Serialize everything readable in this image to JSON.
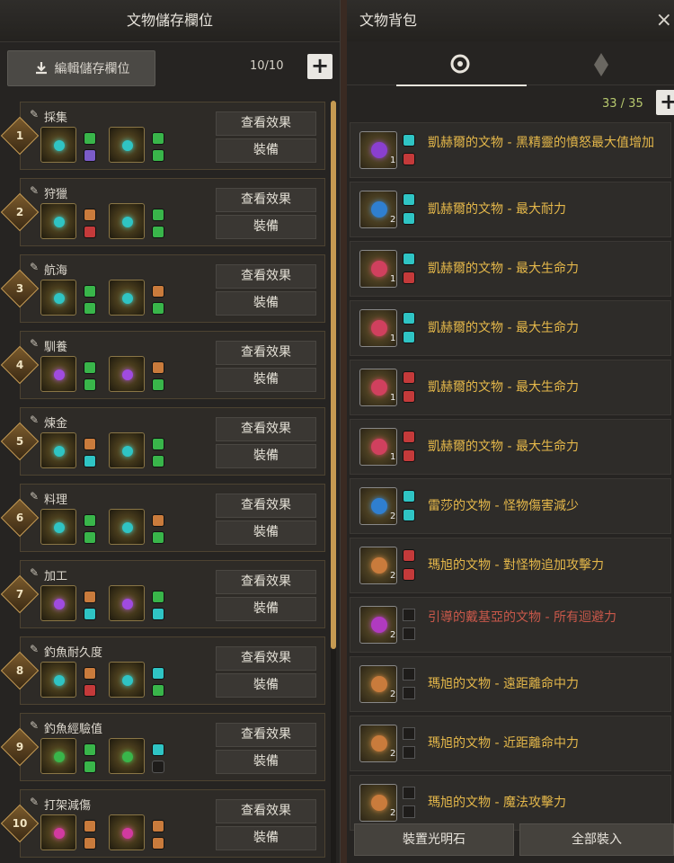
{
  "left_panel": {
    "title": "文物儲存欄位",
    "edit_label": "編輯儲存欄位",
    "slot_count": "10/10",
    "view_label": "查看效果",
    "equip_label": "裝備",
    "slots": [
      {
        "num": "1",
        "name": "採集"
      },
      {
        "num": "2",
        "name": "狩獵"
      },
      {
        "num": "3",
        "name": "航海"
      },
      {
        "num": "4",
        "name": "馴養"
      },
      {
        "num": "5",
        "name": "煉金"
      },
      {
        "num": "6",
        "name": "料理"
      },
      {
        "num": "7",
        "name": "加工"
      },
      {
        "num": "8",
        "name": "釣魚耐久度"
      },
      {
        "num": "9",
        "name": "釣魚經驗值"
      },
      {
        "num": "10",
        "name": "打架減傷"
      }
    ]
  },
  "right_panel": {
    "title": "文物背包",
    "close_icon": "×",
    "count": "33 / 35",
    "items": [
      {
        "name": "凱赫爾的文物 - 黑精靈的憤怒最大值增加",
        "qty": "1"
      },
      {
        "name": "凱赫爾的文物 - 最大耐力",
        "qty": "2"
      },
      {
        "name": "凱赫爾的文物 - 最大生命力",
        "qty": "1"
      },
      {
        "name": "凱赫爾的文物 - 最大生命力",
        "qty": "1"
      },
      {
        "name": "凱赫爾的文物 - 最大生命力",
        "qty": "1"
      },
      {
        "name": "凱赫爾的文物 - 最大生命力",
        "qty": "1"
      },
      {
        "name": "雷莎的文物 - 怪物傷害減少",
        "qty": "2"
      },
      {
        "name": "瑪旭的文物 - 對怪物追加攻擊力",
        "qty": "2"
      },
      {
        "name": "引導的戴基亞的文物 - 所有迴避力",
        "qty": "2"
      },
      {
        "name": "瑪旭的文物 - 遠距離命中力",
        "qty": "2"
      },
      {
        "name": "瑪旭的文物 - 近距離命中力",
        "qty": "2"
      },
      {
        "name": "瑪旭的文物 - 魔法攻擊力",
        "qty": "2"
      }
    ],
    "equip_light_label": "裝置光明石",
    "equip_all_label": "全部裝入"
  },
  "colors": {
    "accent": "#c59a52",
    "item_text": "#e5b84a",
    "item_text_disabled": "#c9584a",
    "count_text": "#b7c96e"
  }
}
